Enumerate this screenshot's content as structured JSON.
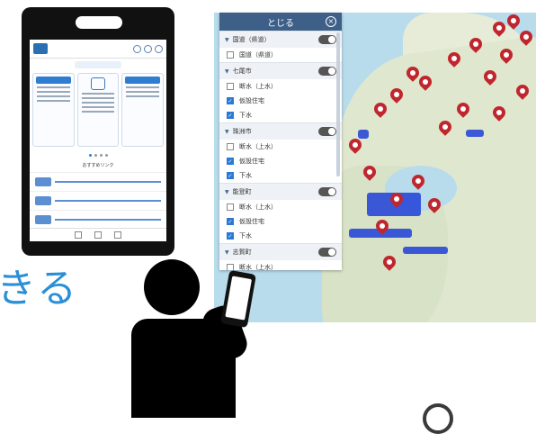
{
  "caption": "きる",
  "panel": {
    "title": "とじる",
    "groups": [
      {
        "label": "国道（県道）",
        "toggle": "off",
        "items": [
          {
            "label": "国道（県道）",
            "checked": false
          }
        ]
      },
      {
        "label": "七尾市",
        "toggle": "off",
        "items": [
          {
            "label": "断水（上水）",
            "checked": false
          },
          {
            "label": "仮設住宅",
            "checked": true
          },
          {
            "label": "下水",
            "checked": true
          }
        ]
      },
      {
        "label": "珠洲市",
        "toggle": "off",
        "items": [
          {
            "label": "断水（上水）",
            "checked": false
          },
          {
            "label": "仮設住宅",
            "checked": true
          },
          {
            "label": "下水",
            "checked": true
          }
        ]
      },
      {
        "label": "能登町",
        "toggle": "off",
        "items": [
          {
            "label": "断水（上水）",
            "checked": false
          },
          {
            "label": "仮設住宅",
            "checked": true
          },
          {
            "label": "下水",
            "checked": true
          }
        ]
      },
      {
        "label": "志賀町",
        "toggle": "off",
        "items": [
          {
            "label": "断水（上水）",
            "checked": false
          }
        ]
      }
    ]
  },
  "phone": {
    "rec_title": "おすすめリンク"
  },
  "colors": {
    "accent": "#2a8fd6",
    "pin": "#c0262d",
    "flood": "#1f3fd8",
    "panel_header": "#3d5f88"
  }
}
